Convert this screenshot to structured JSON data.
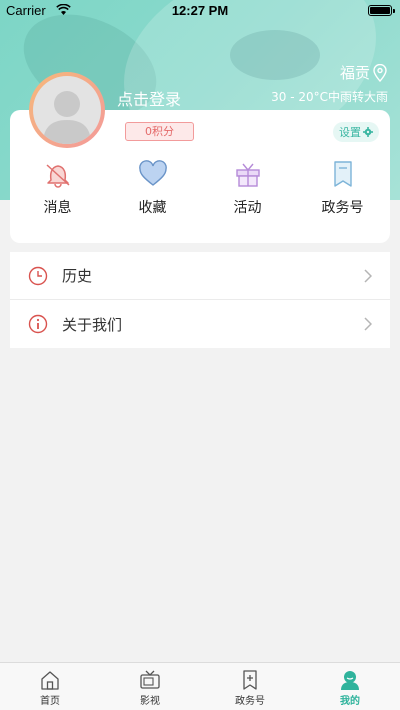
{
  "status_bar": {
    "carrier": "Carrier",
    "time": "12:27 PM"
  },
  "header": {
    "location": "福贡",
    "weather": "30 - 20°C中雨转大雨",
    "login_label": "点击登录",
    "points": "0积分",
    "settings_label": "设置"
  },
  "quick_actions": [
    {
      "label": "消息",
      "icon": "bell-icon",
      "color": "#e0716f"
    },
    {
      "label": "收藏",
      "icon": "heart-icon",
      "color": "#6a94c8"
    },
    {
      "label": "活动",
      "icon": "gift-icon",
      "color": "#b58ad8"
    },
    {
      "label": "政务号",
      "icon": "bookmark-icon",
      "color": "#7db4d8"
    }
  ],
  "menu": [
    {
      "label": "历史",
      "icon": "clock-icon"
    },
    {
      "label": "关于我们",
      "icon": "info-icon"
    }
  ],
  "tabbar": [
    {
      "label": "首页",
      "icon": "home-icon"
    },
    {
      "label": "影视",
      "icon": "tv-icon"
    },
    {
      "label": "政务号",
      "icon": "bookmark-plus-icon"
    },
    {
      "label": "我的",
      "icon": "user-icon",
      "active": true
    }
  ],
  "colors": {
    "accent": "#2fb39c",
    "header": "#7dd6c6",
    "points": "#e46a6a"
  }
}
